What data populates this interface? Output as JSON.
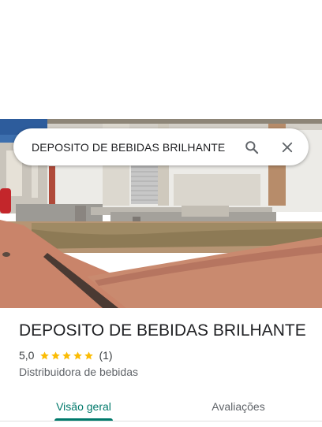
{
  "search": {
    "query": "DEPOSITO DE BEBIDAS BRILHANTE",
    "search_icon": "search-icon",
    "close_icon": "close-icon"
  },
  "place": {
    "name": "DEPOSITO DE BEBIDAS BRILHANTE",
    "rating": "5,0",
    "stars": 5,
    "review_count": "(1)",
    "category": "Distribuidora de bebidas"
  },
  "tabs": [
    {
      "label": "Visão geral",
      "active": true
    },
    {
      "label": "Avaliações",
      "active": false
    }
  ],
  "colors": {
    "accent": "#00796b",
    "star": "#fbbc04"
  }
}
